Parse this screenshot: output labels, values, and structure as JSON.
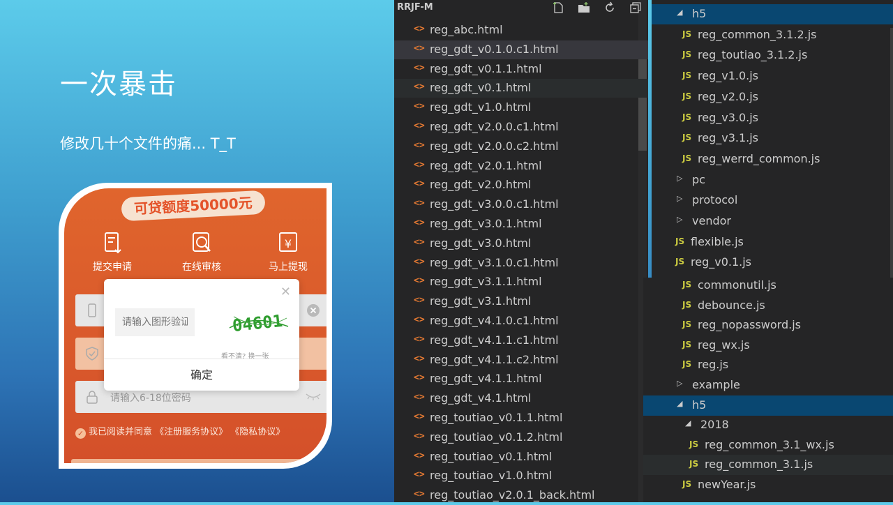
{
  "slide": {
    "title": "一次暴击",
    "subtitle": "修改几十个文件的痛... T_T"
  },
  "phone": {
    "banner": "可贷额度50000元",
    "steps": [
      {
        "label": "提交申请",
        "icon": "document-icon"
      },
      {
        "label": "在线审核",
        "icon": "search-icon"
      },
      {
        "label": "马上提现",
        "icon": "yuan-icon"
      }
    ],
    "password_placeholder": "请输入6-18位密码",
    "agree_text": "我已阅读并同意 《注册服务协议》 《隐私协议》",
    "captcha": {
      "placeholder": "请输入图形验证码",
      "code": "04601",
      "refresh_text": "看不清? 换一张",
      "confirm_label": "确定"
    },
    "colors": {
      "primary": "#d4502a",
      "banner_bg": "#f6e2d0"
    }
  },
  "explorer": {
    "title": "RRJF-M",
    "actions": [
      "new-file-icon",
      "new-folder-icon",
      "refresh-icon",
      "collapse-all-icon"
    ],
    "selected_index": 1,
    "files": [
      "reg_abc.html",
      "reg_gdt_v0.1.0.c1.html",
      "reg_gdt_v0.1.1.html",
      "reg_gdt_v0.1.html",
      "reg_gdt_v1.0.html",
      "reg_gdt_v2.0.0.c1.html",
      "reg_gdt_v2.0.0.c2.html",
      "reg_gdt_v2.0.1.html",
      "reg_gdt_v2.0.html",
      "reg_gdt_v3.0.0.c1.html",
      "reg_gdt_v3.0.1.html",
      "reg_gdt_v3.0.html",
      "reg_gdt_v3.1.0.c1.html",
      "reg_gdt_v3.1.1.html",
      "reg_gdt_v3.1.html",
      "reg_gdt_v4.1.0.c1.html",
      "reg_gdt_v4.1.1.c1.html",
      "reg_gdt_v4.1.1.c2.html",
      "reg_gdt_v4.1.1.html",
      "reg_gdt_v4.1.html",
      "reg_toutiao_v0.1.1.html",
      "reg_toutiao_v0.1.2.html",
      "reg_toutiao_v0.1.html",
      "reg_toutiao_v1.0.html",
      "reg_toutiao_v2.0.1_back.html"
    ]
  },
  "tree_top": {
    "items": [
      {
        "type": "folder-open",
        "name": "h5"
      },
      {
        "type": "js",
        "name": "reg_common_3.1.2.js"
      },
      {
        "type": "js",
        "name": "reg_toutiao_3.1.2.js"
      },
      {
        "type": "js",
        "name": "reg_v1.0.js"
      },
      {
        "type": "js",
        "name": "reg_v2.0.js"
      },
      {
        "type": "js",
        "name": "reg_v3.0.js"
      },
      {
        "type": "js",
        "name": "reg_v3.1.js"
      },
      {
        "type": "js",
        "name": "reg_werrd_common.js"
      },
      {
        "type": "folder",
        "name": "pc"
      },
      {
        "type": "folder",
        "name": "protocol"
      },
      {
        "type": "folder",
        "name": "vendor"
      },
      {
        "type": "js",
        "name": "flexible.js"
      },
      {
        "type": "js",
        "name": "reg_v0.1.js"
      }
    ]
  },
  "tree_bottom": {
    "items": [
      {
        "type": "js",
        "name": "commonutil.js"
      },
      {
        "type": "js",
        "name": "debounce.js"
      },
      {
        "type": "js",
        "name": "reg_nopassword.js"
      },
      {
        "type": "js",
        "name": "reg_wx.js"
      },
      {
        "type": "js",
        "name": "reg.js"
      },
      {
        "type": "folder",
        "name": "example"
      },
      {
        "type": "folder-open",
        "name": "h5"
      },
      {
        "type": "folder-open",
        "name": "2018"
      },
      {
        "type": "js",
        "name": "reg_common_3.1_wx.js"
      },
      {
        "type": "js",
        "name": "reg_common_3.1.js"
      },
      {
        "type": "js",
        "name": "newYear.js"
      }
    ]
  },
  "labels": {
    "js": "JS",
    "file_icon": "<>"
  }
}
